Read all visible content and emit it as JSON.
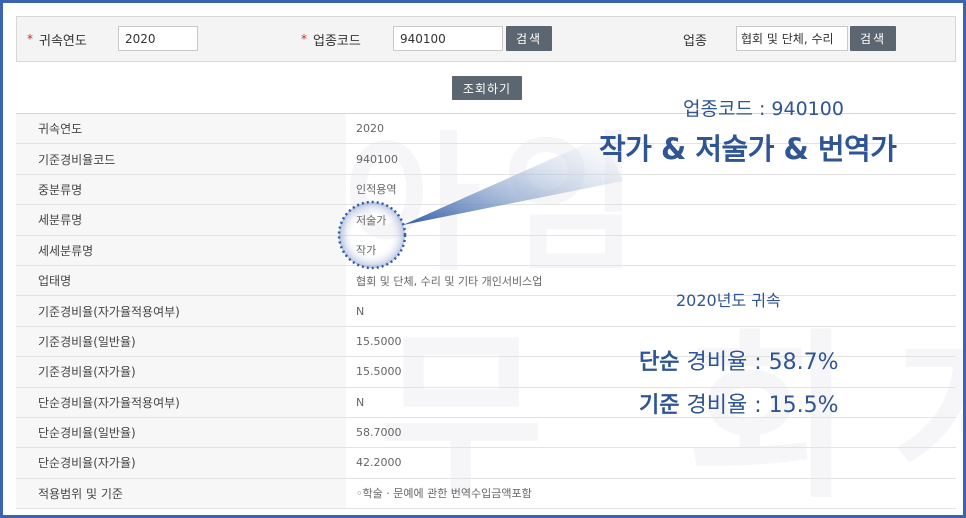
{
  "search": {
    "year_label": "귀속연도",
    "year_value": "2020",
    "code_label": "업종코드",
    "code_value": "940100",
    "code_search_btn": "검색",
    "industry_label": "업종",
    "industry_value": "협회 및 단체, 수리",
    "industry_search_btn": "검색",
    "query_btn": "조회하기"
  },
  "rows": [
    {
      "label": "귀속연도",
      "value": "2020"
    },
    {
      "label": "기준경비율코드",
      "value": "940100"
    },
    {
      "label": "중분류명",
      "value": "인적용역"
    },
    {
      "label": "세분류명",
      "value": "저술가"
    },
    {
      "label": "세세분류명",
      "value": "작가"
    },
    {
      "label": "업태명",
      "value": "협회 및 단체, 수리 및 기타 개인서비스업"
    },
    {
      "label": "기준경비율(자가율적용여부)",
      "value": "N"
    },
    {
      "label": "기준경비율(일반율)",
      "value": "15.5000"
    },
    {
      "label": "기준경비율(자가율)",
      "value": "15.5000"
    },
    {
      "label": "단순경비율(자가율적용여부)",
      "value": "N"
    },
    {
      "label": "단순경비율(일반율)",
      "value": "58.7000"
    },
    {
      "label": "단순경비율(자가율)",
      "value": "42.2000"
    },
    {
      "label": "적용범위 및 기준",
      "value": "◦학술 · 문예에 관한 번역수입금액포함"
    }
  ],
  "annotation": {
    "code_text": "업종코드 : 940100",
    "title_text": "작가 & 저술가 & 번역가",
    "year_text": "2020년도 귀속",
    "simple_bold": "단순",
    "simple_rest": " 경비율 : 58.7%",
    "standard_bold": "기준",
    "standard_rest": " 경비율 : 15.5%"
  },
  "watermark": {
    "line1": "아임",
    "line2": "세무 회계"
  },
  "colors": {
    "frame": "#3b64b0",
    "annotation": "#2f5595",
    "button": "#5c6670",
    "required_star": "#d22a2a"
  }
}
